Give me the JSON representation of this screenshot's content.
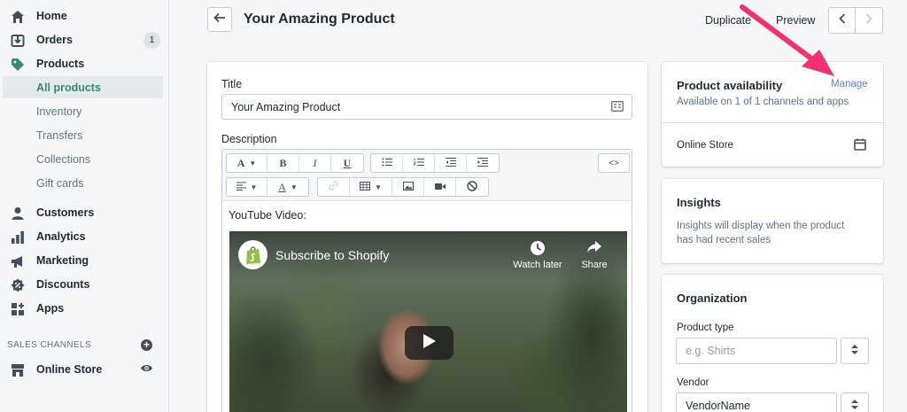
{
  "sidebar": {
    "items": [
      {
        "label": "Home",
        "icon": "home-icon"
      },
      {
        "label": "Orders",
        "icon": "orders-icon",
        "badge": "1"
      },
      {
        "label": "Products",
        "icon": "tag-icon"
      },
      {
        "label": "Customers",
        "icon": "person-icon"
      },
      {
        "label": "Analytics",
        "icon": "bar-chart-icon"
      },
      {
        "label": "Marketing",
        "icon": "megaphone-icon"
      },
      {
        "label": "Discounts",
        "icon": "discount-icon"
      },
      {
        "label": "Apps",
        "icon": "apps-icon"
      }
    ],
    "product_sub_items": [
      "All products",
      "Inventory",
      "Transfers",
      "Collections",
      "Gift cards"
    ],
    "sales_channels_label": "SALES CHANNELS",
    "online_store_label": "Online Store"
  },
  "header": {
    "title": "Your Amazing Product",
    "duplicate": "Duplicate",
    "preview": "Preview"
  },
  "form": {
    "title_label": "Title",
    "title_value": "Your Amazing Product",
    "description_label": "Description",
    "editor_text": "YouTube Video:",
    "toolbar": {
      "font": "A",
      "bold": "B",
      "italic": "I",
      "underline": "U",
      "code": "<>"
    },
    "video": {
      "title": "Subscribe to Shopify",
      "watch_later": "Watch later",
      "share": "Share"
    }
  },
  "availability": {
    "heading": "Product availability",
    "manage": "Manage",
    "subtext": "Available on 1 of 1 channels and apps",
    "channel": "Online Store"
  },
  "insights": {
    "heading": "Insights",
    "text": "Insights will display when the product has had recent sales"
  },
  "organization": {
    "heading": "Organization",
    "product_type_label": "Product type",
    "product_type_placeholder": "e.g. Shirts",
    "vendor_label": "Vendor",
    "vendor_value": "VendorName"
  },
  "colors": {
    "active_green": "#3a8a67",
    "link_blue": "#5b84c4",
    "annotation_arrow": "#f5306f"
  }
}
